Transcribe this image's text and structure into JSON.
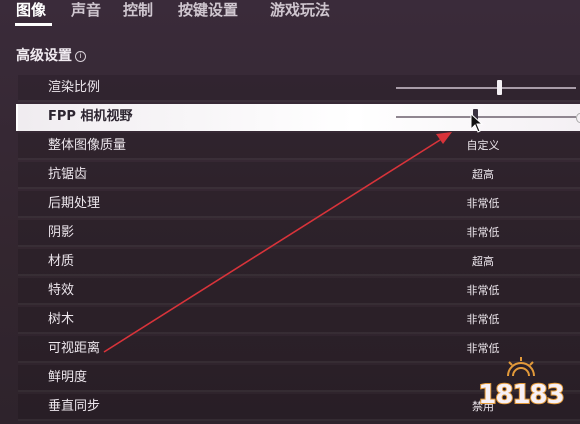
{
  "tabs": [
    {
      "label": "图像",
      "active": true
    },
    {
      "label": "声音",
      "active": false
    },
    {
      "label": "控制",
      "active": false
    },
    {
      "label": "按键设置",
      "active": false
    },
    {
      "label": "游戏玩法",
      "active": false
    }
  ],
  "section": {
    "title": "高级设置",
    "info_glyph": "i"
  },
  "settings": [
    {
      "label": "渲染比例",
      "kind": "slider",
      "level": 0.57
    },
    {
      "label": "FPP 相机视野",
      "kind": "slider",
      "level": 0.44
    },
    {
      "label": "整体图像质量",
      "kind": "value",
      "value": "自定义"
    },
    {
      "label": "抗锯齿",
      "kind": "value",
      "value": "超高"
    },
    {
      "label": "后期处理",
      "kind": "value",
      "value": "非常低"
    },
    {
      "label": "阴影",
      "kind": "value",
      "value": "非常低"
    },
    {
      "label": "材质",
      "kind": "value",
      "value": "超高"
    },
    {
      "label": "特效",
      "kind": "value",
      "value": "非常低"
    },
    {
      "label": "树木",
      "kind": "value",
      "value": "非常低"
    },
    {
      "label": "可视距离",
      "kind": "value",
      "value": "非常低"
    },
    {
      "label": "鲜明度",
      "kind": "value",
      "value": ""
    },
    {
      "label": "垂直同步",
      "kind": "value",
      "value": "禁用"
    }
  ],
  "watermark": {
    "text": "18183"
  },
  "colors": {
    "annotation_arrow": "#d8333a",
    "highlight_row": "#f4f0f4",
    "background": "#33262f"
  },
  "icons": {
    "info": "info-circle-icon",
    "cursor": "mouse-cursor-icon"
  }
}
